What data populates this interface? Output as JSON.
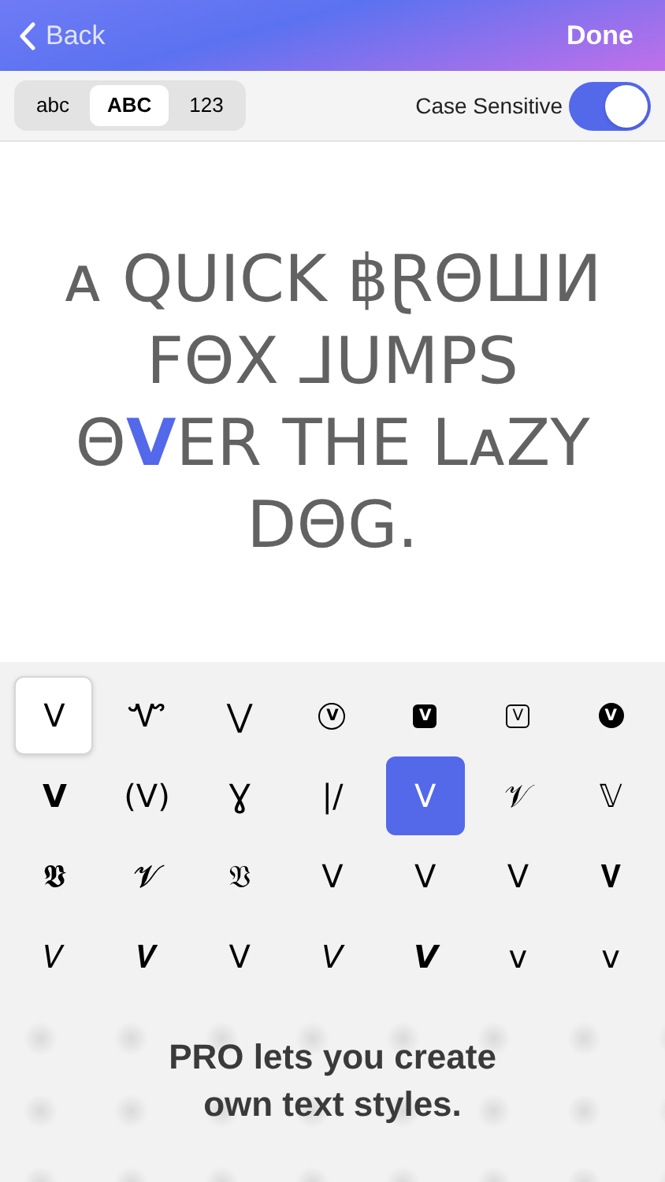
{
  "nav": {
    "back": "Back",
    "done": "Done"
  },
  "case_tabs": [
    {
      "label": "abc",
      "selected": false
    },
    {
      "label": "ABC",
      "selected": true
    },
    {
      "label": "123",
      "selected": false
    }
  ],
  "case_sensitive": {
    "label": "Case Sensitive",
    "on": true
  },
  "preview": [
    {
      "text": "ᴀ QUICK ฿ⱤΘШИ FΘX ⅃UMPS Θ",
      "highlight": false
    },
    {
      "text": "V",
      "highlight": true
    },
    {
      "text": "ER THE LᴀZY DΘG.",
      "highlight": false
    }
  ],
  "glyphs": [
    {
      "char": "V",
      "kind": "plain",
      "selected": false,
      "original": true
    },
    {
      "char": "Ꮙ",
      "kind": "plain",
      "selected": false,
      "original": false
    },
    {
      "char": "⋁",
      "kind": "plain",
      "selected": false,
      "original": false
    },
    {
      "char": "V",
      "kind": "circled",
      "selected": false,
      "original": false
    },
    {
      "char": "V",
      "kind": "filled-square",
      "selected": false,
      "original": false
    },
    {
      "char": "V",
      "kind": "outline-square",
      "selected": false,
      "original": false
    },
    {
      "char": "V",
      "kind": "filled-circle",
      "selected": false,
      "original": false
    },
    {
      "char": "𝗩",
      "kind": "plain",
      "selected": false,
      "original": false
    },
    {
      "char": "(V)",
      "kind": "plain",
      "selected": false,
      "original": false
    },
    {
      "char": "Ɣ",
      "kind": "plain",
      "selected": false,
      "original": false
    },
    {
      "char": "|/",
      "kind": "plain",
      "selected": false,
      "original": false
    },
    {
      "char": "V",
      "kind": "plain",
      "selected": true,
      "original": false
    },
    {
      "char": "𝒱",
      "kind": "plain",
      "selected": false,
      "original": false
    },
    {
      "char": "𝕍",
      "kind": "plain",
      "selected": false,
      "original": false
    },
    {
      "char": "𝖁",
      "kind": "plain",
      "selected": false,
      "original": false
    },
    {
      "char": "𝓥",
      "kind": "plain",
      "selected": false,
      "original": false
    },
    {
      "char": "𝔙",
      "kind": "plain",
      "selected": false,
      "original": false
    },
    {
      "char": "Ⅴ",
      "kind": "plain",
      "selected": false,
      "original": false
    },
    {
      "char": "V",
      "kind": "plain",
      "selected": false,
      "original": false
    },
    {
      "char": "V",
      "kind": "plain",
      "selected": false,
      "original": false
    },
    {
      "char": "𝐕",
      "kind": "plain",
      "selected": false,
      "original": false
    },
    {
      "char": "𝑉",
      "kind": "plain",
      "selected": false,
      "original": false
    },
    {
      "char": "𝑽",
      "kind": "plain",
      "selected": false,
      "original": false
    },
    {
      "char": "V",
      "kind": "plain",
      "selected": false,
      "original": false
    },
    {
      "char": "𝘝",
      "kind": "plain",
      "selected": false,
      "original": false
    },
    {
      "char": "𝙑",
      "kind": "plain",
      "selected": false,
      "original": false
    },
    {
      "char": "ᴠ",
      "kind": "plain",
      "selected": false,
      "original": false
    },
    {
      "char": "v",
      "kind": "plain",
      "selected": false,
      "original": false
    }
  ],
  "pro_notice": "PRO lets you create own text styles."
}
